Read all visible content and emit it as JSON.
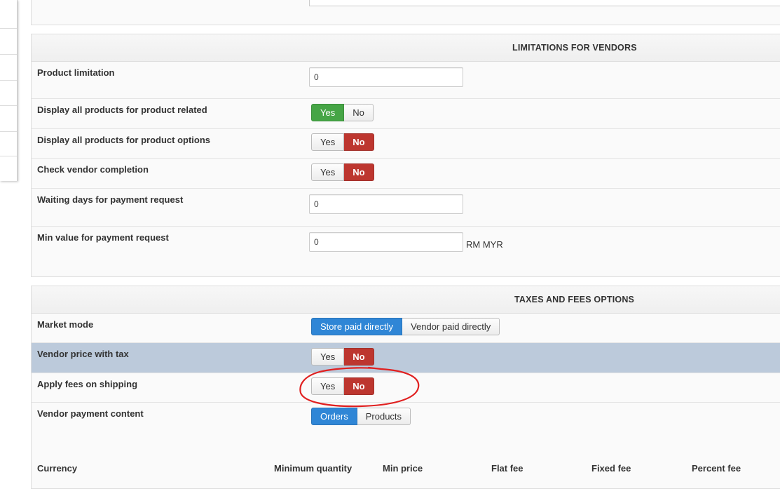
{
  "limitations": {
    "title": "LIMITATIONS FOR VENDORS",
    "product_limitation": {
      "label": "Product limitation",
      "value": "0"
    },
    "display_related": {
      "label": "Display all products for product related",
      "yes": "Yes",
      "no": "No",
      "selected": "Yes"
    },
    "display_options": {
      "label": "Display all products for product options",
      "yes": "Yes",
      "no": "No",
      "selected": "No"
    },
    "vendor_completion": {
      "label": "Check vendor completion",
      "yes": "Yes",
      "no": "No",
      "selected": "No"
    },
    "waiting_days": {
      "label": "Waiting days for payment request",
      "value": "0"
    },
    "min_value": {
      "label": "Min value for payment request",
      "value": "0",
      "unit": "RM MYR"
    }
  },
  "taxes": {
    "title": "TAXES AND FEES OPTIONS",
    "market_mode": {
      "label": "Market mode",
      "option1": "Store paid directly",
      "option2": "Vendor paid directly",
      "selected": "Store paid directly"
    },
    "vendor_price_tax": {
      "label": "Vendor price with tax",
      "yes": "Yes",
      "no": "No",
      "selected": "No"
    },
    "fees_shipping": {
      "label": "Apply fees on shipping",
      "yes": "Yes",
      "no": "No",
      "selected": "No"
    },
    "payment_content": {
      "label": "Vendor payment content",
      "option1": "Orders",
      "option2": "Products",
      "selected": "Orders"
    }
  },
  "fees_table": {
    "headers": [
      "Currency",
      "Minimum quantity",
      "Min price",
      "Flat fee",
      "Fixed fee",
      "Percent fee"
    ]
  },
  "colors": {
    "yes_active": "#46a546",
    "no_active": "#bd362f",
    "blue_active": "#2f86d6",
    "highlight_row": "#bccadb",
    "annotation": "#e02020"
  }
}
